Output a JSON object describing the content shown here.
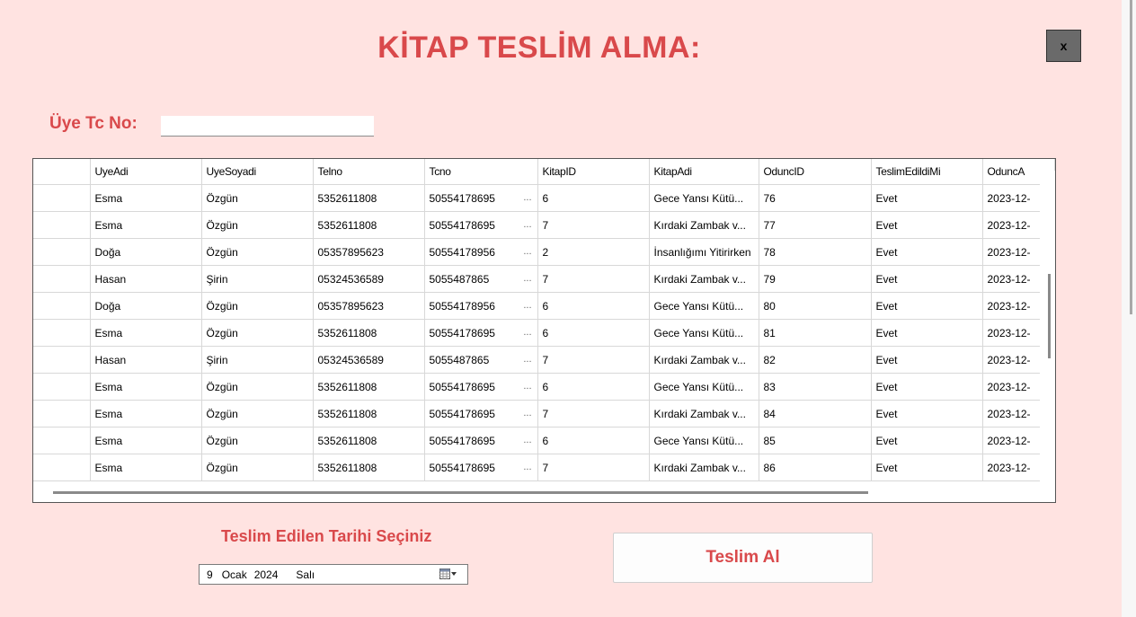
{
  "window": {
    "title": "KİTAP TESLİM ALMA:",
    "close_label": "x"
  },
  "member_search": {
    "label": "Üye Tc No:",
    "value": ""
  },
  "grid": {
    "columns": [
      "",
      "UyeAdi",
      "UyeSoyadi",
      "Telno",
      "Tcno",
      "KitapID",
      "KitapAdi",
      "OduncID",
      "TeslimEdildiMi",
      "OduncA"
    ],
    "rows": [
      {
        "uye_adi": "Esma",
        "uye_soyadi": "Özgün",
        "telno": "5352611808",
        "tcno": "50554178695",
        "kitap_id": "6",
        "kitap_adi": "Gece Yansı Kütü...",
        "odunc_id": "76",
        "teslim": "Evet",
        "odunc_tarih": "2023-12-"
      },
      {
        "uye_adi": "Esma",
        "uye_soyadi": "Özgün",
        "telno": "5352611808",
        "tcno": "50554178695",
        "kitap_id": "7",
        "kitap_adi": "Kırdaki Zambak v...",
        "odunc_id": "77",
        "teslim": "Evet",
        "odunc_tarih": "2023-12-"
      },
      {
        "uye_adi": "Doğa",
        "uye_soyadi": "Özgün",
        "telno": "05357895623",
        "tcno": "50554178956",
        "kitap_id": "2",
        "kitap_adi": "İnsanlığımı Yitirirken",
        "odunc_id": "78",
        "teslim": "Evet",
        "odunc_tarih": "2023-12-"
      },
      {
        "uye_adi": "Hasan",
        "uye_soyadi": "Şirin",
        "telno": "05324536589",
        "tcno": "5055487865",
        "kitap_id": "7",
        "kitap_adi": "Kırdaki Zambak v...",
        "odunc_id": "79",
        "teslim": "Evet",
        "odunc_tarih": "2023-12-"
      },
      {
        "uye_adi": "Doğa",
        "uye_soyadi": "Özgün",
        "telno": "05357895623",
        "tcno": "50554178956",
        "kitap_id": "6",
        "kitap_adi": "Gece Yansı Kütü...",
        "odunc_id": "80",
        "teslim": "Evet",
        "odunc_tarih": "2023-12-"
      },
      {
        "uye_adi": "Esma",
        "uye_soyadi": "Özgün",
        "telno": "5352611808",
        "tcno": "50554178695",
        "kitap_id": "6",
        "kitap_adi": "Gece Yansı Kütü...",
        "odunc_id": "81",
        "teslim": "Evet",
        "odunc_tarih": "2023-12-"
      },
      {
        "uye_adi": "Hasan",
        "uye_soyadi": "Şirin",
        "telno": "05324536589",
        "tcno": "5055487865",
        "kitap_id": "7",
        "kitap_adi": "Kırdaki Zambak v...",
        "odunc_id": "82",
        "teslim": "Evet",
        "odunc_tarih": "2023-12-"
      },
      {
        "uye_adi": "Esma",
        "uye_soyadi": "Özgün",
        "telno": "5352611808",
        "tcno": "50554178695",
        "kitap_id": "6",
        "kitap_adi": "Gece Yansı Kütü...",
        "odunc_id": "83",
        "teslim": "Evet",
        "odunc_tarih": "2023-12-"
      },
      {
        "uye_adi": "Esma",
        "uye_soyadi": "Özgün",
        "telno": "5352611808",
        "tcno": "50554178695",
        "kitap_id": "7",
        "kitap_adi": "Kırdaki Zambak v...",
        "odunc_id": "84",
        "teslim": "Evet",
        "odunc_tarih": "2023-12-"
      },
      {
        "uye_adi": "Esma",
        "uye_soyadi": "Özgün",
        "telno": "5352611808",
        "tcno": "50554178695",
        "kitap_id": "6",
        "kitap_adi": "Gece Yansı Kütü...",
        "odunc_id": "85",
        "teslim": "Evet",
        "odunc_tarih": "2023-12-"
      },
      {
        "uye_adi": "Esma",
        "uye_soyadi": "Özgün",
        "telno": "5352611808",
        "tcno": "50554178695",
        "kitap_id": "7",
        "kitap_adi": "Kırdaki Zambak v...",
        "odunc_id": "86",
        "teslim": "Evet",
        "odunc_tarih": "2023-12-"
      }
    ],
    "tcno_ellipsis": "..."
  },
  "date_section": {
    "label": "Teslim Edilen Tarihi Seçiniz",
    "day": "9",
    "month": "Ocak",
    "year": "2024",
    "weekday": "Salı",
    "icon": "calendar-dropdown-icon"
  },
  "submit": {
    "label": "Teslim Al"
  },
  "colors": {
    "background": "#ffe3e1",
    "accent": "#d9494b"
  }
}
